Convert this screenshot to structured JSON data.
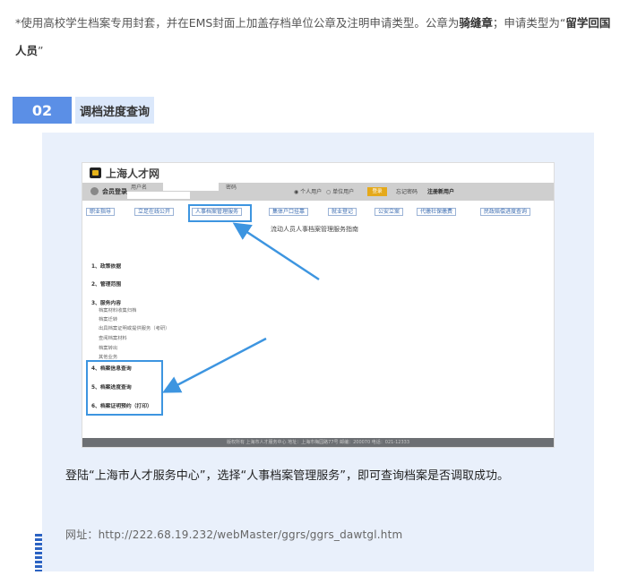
{
  "intro": {
    "text1": "*使用高校学生档案专用封套，并在EMS封面上加盖存档单位公章及注明申请类型。公章为",
    "bold1": "骑缝章",
    "text2": "；申请类型为“",
    "bold2": "留学回国人员",
    "text3": "”"
  },
  "section": {
    "number": "02",
    "title": "调档进度查询"
  },
  "screenshot": {
    "site_name": "上海人才网",
    "login": {
      "title": "会员登录",
      "username_label": "用户名",
      "password_label": "密码",
      "radio_personal": "◉ 个人用户",
      "radio_unit": "○ 单位用户",
      "login_button": "登录",
      "forgot": "忘记密码",
      "register": "注册新用户"
    },
    "nav": [
      "职业指导",
      "立足在线公开",
      "人事档案管理服务",
      "集体户口挂靠",
      "就业登记",
      "公安立案",
      "代缴社保缴费",
      "民政赔偿进度查询"
    ],
    "guide_title": "流动人员人事档案管理服务指南",
    "items": [
      "1、政策依据",
      "2、管理范围",
      "3、服务内容",
      "4、档案信息查询",
      "5、档案进度查询",
      "6、档案证明预约（打印）"
    ],
    "subitems": [
      "档案材料收集归档",
      "档案迁转",
      "出具档案证明或提供服务（考研）",
      "查阅档案材料",
      "档案转出",
      "其他业务"
    ],
    "footer": "版权所有 上海市人才服务中心 地址：上海市梅园路77号 邮编：200070 电话：021-12333"
  },
  "description": "登陆“上海市人才服务中心”，选择“人事档案管理服务”，即可查询档案是否调取成功。",
  "url_line": "网址：http://222.68.19.232/webMaster/ggrs/ggrs_dawtgl.htm",
  "colors": {
    "accent": "#5b8fe6",
    "accent_light": "#dbe8fb",
    "card_bg": "#e9f0fb",
    "highlight": "#3d95e0"
  }
}
